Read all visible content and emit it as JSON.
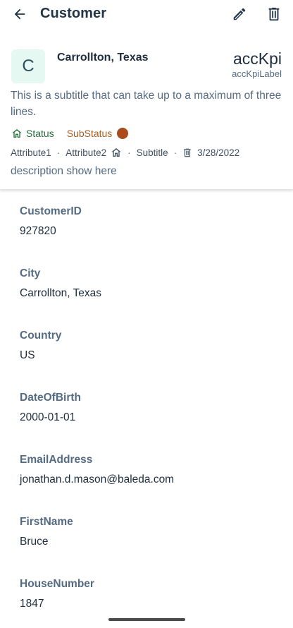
{
  "appbar": {
    "title": "Customer",
    "back_icon": "arrow-back-icon",
    "edit_icon": "pencil-icon",
    "delete_icon": "trash-icon"
  },
  "header": {
    "avatar_letter": "C",
    "title": "Carrollton, Texas",
    "kpi": "accKpi",
    "kpi_label": "accKpiLabel",
    "subtitle": "This is a subtitle that can take up to a maximum of three lines.",
    "status": "Status",
    "substatus": "SubStatus",
    "attribute1": "Attribute1",
    "attribute2": "Attribute2",
    "attr_subtitle": "Subtitle",
    "date": "3/28/2022",
    "description": "description show here"
  },
  "fields": [
    {
      "label": "CustomerID",
      "value": "927820"
    },
    {
      "label": "City",
      "value": "Carrollton, Texas"
    },
    {
      "label": "Country",
      "value": "US"
    },
    {
      "label": "DateOfBirth",
      "value": "2000-01-01"
    },
    {
      "label": "EmailAddress",
      "value": "jonathan.d.mason@baleda.com"
    },
    {
      "label": "FirstName",
      "value": "Bruce"
    },
    {
      "label": "HouseNumber",
      "value": "1847"
    }
  ],
  "colors": {
    "status_green": "#256f3a",
    "substatus_orange": "#a45d25",
    "substatus_dot": "#aa4b1e",
    "avatar_bg": "#e6f8f2"
  }
}
